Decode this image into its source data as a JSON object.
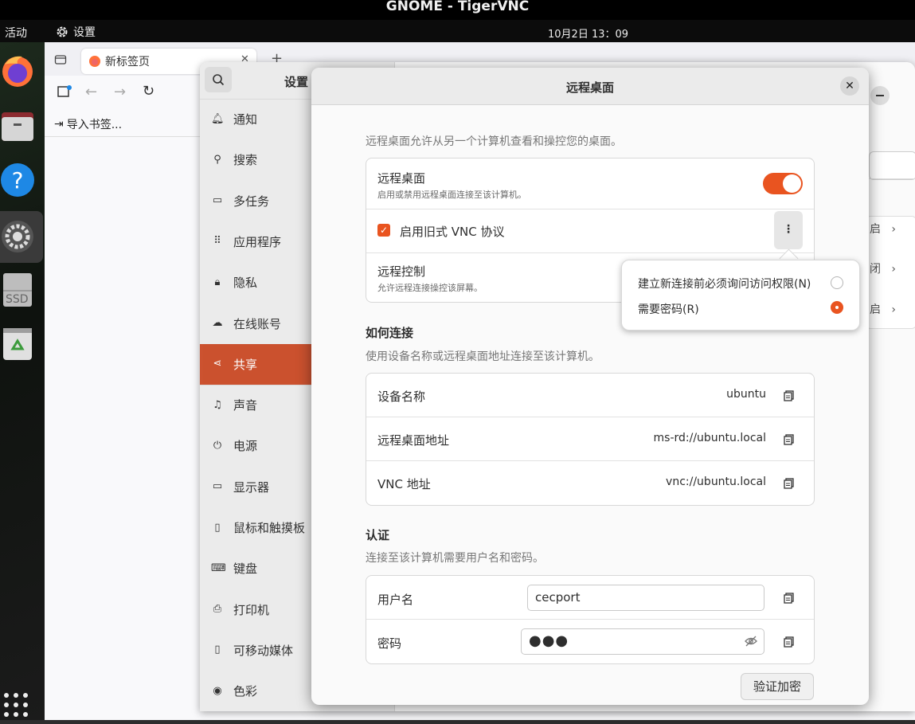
{
  "vnc": {
    "title": "GNOME - TigerVNC"
  },
  "topbar": {
    "activities": "活动",
    "app_name": "设置",
    "clock": "10月2日  13：09"
  },
  "dock": {
    "items": [
      "firefox-icon",
      "files-icon",
      "help-icon",
      "settings-icon",
      "ssd-drive-icon",
      "trash-icon",
      "app-grid-icon"
    ],
    "ssd_label": "SSD"
  },
  "browser": {
    "tab_title": "新标签页",
    "new_tab": "+",
    "import_bookmarks": "导入书签..."
  },
  "settings": {
    "title": "设置",
    "sidebar": [
      {
        "label": "通知",
        "icon": "bell-icon"
      },
      {
        "label": "搜索",
        "icon": "search-icon"
      },
      {
        "label": "多任务",
        "icon": "multitasking-icon"
      },
      {
        "label": "应用程序",
        "icon": "apps-grid-icon"
      },
      {
        "label": "隐私",
        "icon": "lock-icon"
      },
      {
        "label": "在线账号",
        "icon": "cloud-icon"
      },
      {
        "label": "共享",
        "icon": "share-icon"
      },
      {
        "label": "声音",
        "icon": "music-note-icon"
      },
      {
        "label": "电源",
        "icon": "power-icon"
      },
      {
        "label": "显示器",
        "icon": "display-icon"
      },
      {
        "label": "鼠标和触摸板",
        "icon": "mouse-icon"
      },
      {
        "label": "键盘",
        "icon": "keyboard-icon"
      },
      {
        "label": "打印机",
        "icon": "printer-icon"
      },
      {
        "label": "可移动媒体",
        "icon": "removable-media-icon"
      },
      {
        "label": "色彩",
        "icon": "color-icon"
      }
    ],
    "selected": "共享",
    "right_rows": [
      "启",
      "闭",
      "启"
    ]
  },
  "dialog": {
    "title": "远程桌面",
    "intro": "远程桌面允许从另一个计算机查看和操控您的桌面。",
    "remote_desktop": {
      "title": "远程桌面",
      "subtitle": "启用或禁用远程桌面连接至该计算机。",
      "enabled": true
    },
    "legacy_vnc": {
      "label": "启用旧式 VNC 协议",
      "checked": true,
      "menu": "⋮"
    },
    "remote_control": {
      "title": "远程控制",
      "subtitle": "允许远程连接操控该屏幕。"
    },
    "how_to_connect": {
      "heading": "如何连接",
      "desc": "使用设备名称或远程桌面地址连接至该计算机。",
      "rows": [
        {
          "label": "设备名称",
          "value": "ubuntu"
        },
        {
          "label": "远程桌面地址",
          "value": "ms-rd://ubuntu.local"
        },
        {
          "label": "VNC 地址",
          "value": "vnc://ubuntu.local"
        }
      ]
    },
    "auth": {
      "heading": "认证",
      "desc": "连接至该计算机需要用户名和密码。",
      "username_label": "用户名",
      "username_value": "cecport",
      "password_label": "密码",
      "password_value": "●●●",
      "verify_button": "验证加密"
    }
  },
  "popover": {
    "options": [
      {
        "label": "建立新连接前必须询问访问权限(N)",
        "selected": false
      },
      {
        "label": "需要密码(R)",
        "selected": true
      }
    ]
  },
  "colors": {
    "accent": "#e95420",
    "selected_sidebar": "#c9441f"
  }
}
